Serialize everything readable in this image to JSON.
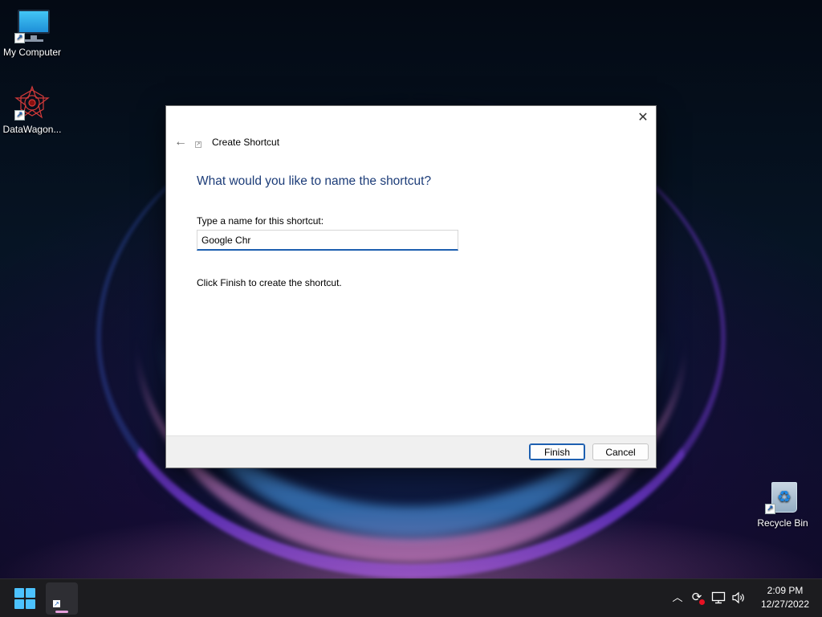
{
  "desktop": {
    "icons": [
      {
        "label": "My Computer",
        "icon": "monitor-icon"
      },
      {
        "label": "DataWagon...",
        "icon": "datawagon-app-icon"
      },
      {
        "label": "Recycle Bin",
        "icon": "recycle-bin-icon"
      }
    ]
  },
  "dialog": {
    "title": "Create Shortcut",
    "heading": "What would you like to name the shortcut?",
    "field_label": "Type a name for this shortcut:",
    "name_value": "Google Chr",
    "hint": "Click Finish to create the shortcut.",
    "finish_label": "Finish",
    "cancel_label": "Cancel",
    "close_glyph": "✕",
    "back_glyph": "←"
  },
  "taskbar": {
    "start_icon": "windows-start-icon",
    "time": "2:09 PM",
    "date": "12/27/2022",
    "tray_icons": [
      "chevron-up-icon",
      "sync-icon",
      "network-icon",
      "volume-icon"
    ]
  },
  "colors": {
    "accent": "#1d5fb0",
    "heading": "#1c3c78",
    "taskbar": "#1c1c1f",
    "start": "#4cc2ff"
  }
}
